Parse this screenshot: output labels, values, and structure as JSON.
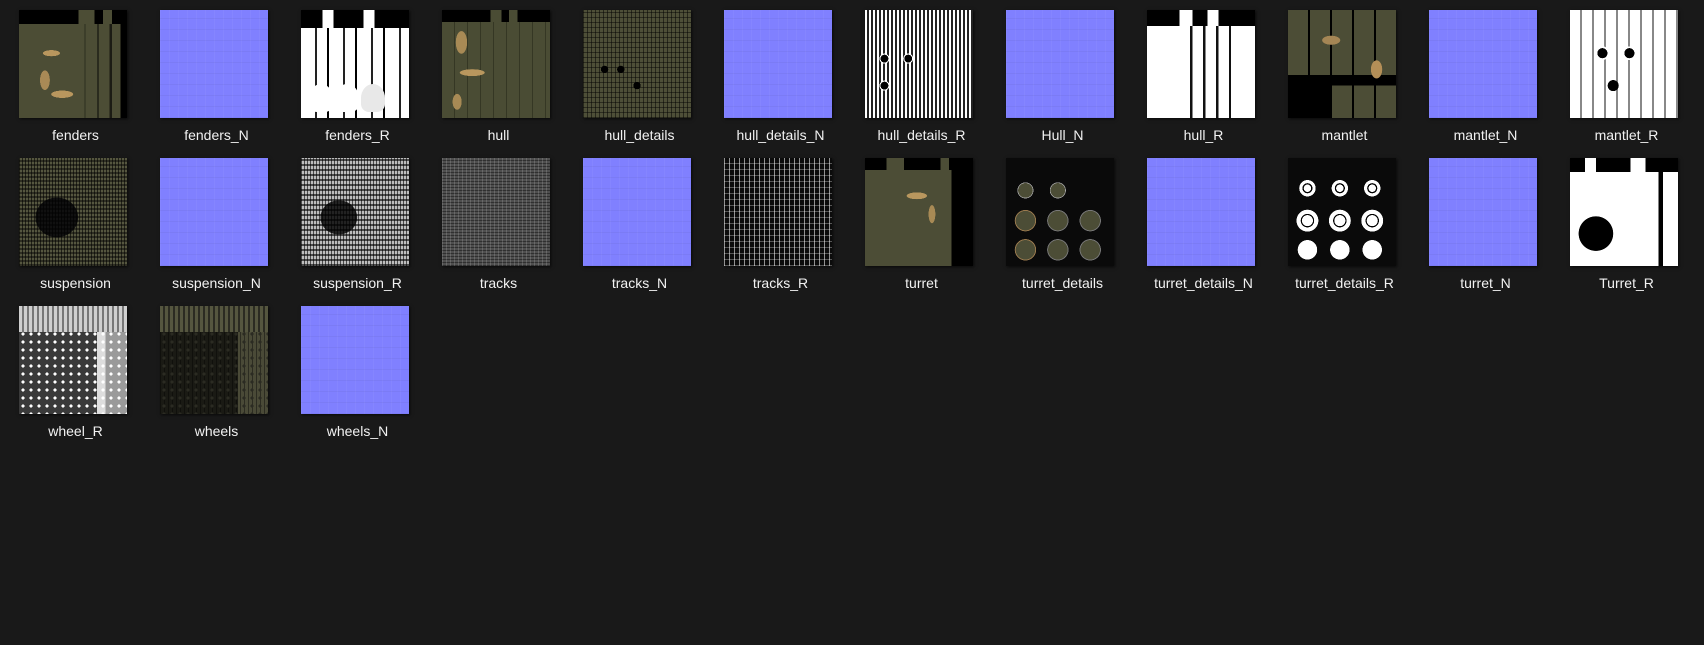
{
  "files": [
    {
      "name": "fenders",
      "thumb": "t-camo"
    },
    {
      "name": "fenders_N",
      "thumb": "t-normal"
    },
    {
      "name": "fenders_R",
      "thumb": "t-mask-white"
    },
    {
      "name": "hull",
      "thumb": "t-hull"
    },
    {
      "name": "hull_details",
      "thumb": "t-noise-olive"
    },
    {
      "name": "hull_details_N",
      "thumb": "t-normal"
    },
    {
      "name": "hull_details_R",
      "thumb": "t-noise-bw"
    },
    {
      "name": "Hull_N",
      "thumb": "t-normal"
    },
    {
      "name": "hull_R",
      "thumb": "t-white-blocks"
    },
    {
      "name": "mantlet",
      "thumb": "t-mantlet"
    },
    {
      "name": "mantlet_N",
      "thumb": "t-normal"
    },
    {
      "name": "mantlet_R",
      "thumb": "t-white-mixed"
    },
    {
      "name": "suspension",
      "thumb": "t-susp"
    },
    {
      "name": "suspension_N",
      "thumb": "t-normal"
    },
    {
      "name": "suspension_R",
      "thumb": "t-susp-r"
    },
    {
      "name": "tracks",
      "thumb": "t-tracks"
    },
    {
      "name": "tracks_N",
      "thumb": "t-normal"
    },
    {
      "name": "tracks_R",
      "thumb": "t-tracks-r"
    },
    {
      "name": "turret",
      "thumb": "t-turret"
    },
    {
      "name": "turret_details",
      "thumb": "t-tdetails"
    },
    {
      "name": "turret_details_N",
      "thumb": "t-normal"
    },
    {
      "name": "turret_details_R",
      "thumb": "t-tdetails-r"
    },
    {
      "name": "turret_N",
      "thumb": "t-normal"
    },
    {
      "name": "Turret_R",
      "thumb": "t-turret-r"
    },
    {
      "name": "wheel_R",
      "thumb": "t-wheel-r"
    },
    {
      "name": "wheels",
      "thumb": "t-wheels"
    },
    {
      "name": "wheels_N",
      "thumb": "t-normal"
    }
  ],
  "colors": {
    "background": "#191919",
    "label": "#f2f2f2",
    "normal_map": "#8080ff"
  }
}
